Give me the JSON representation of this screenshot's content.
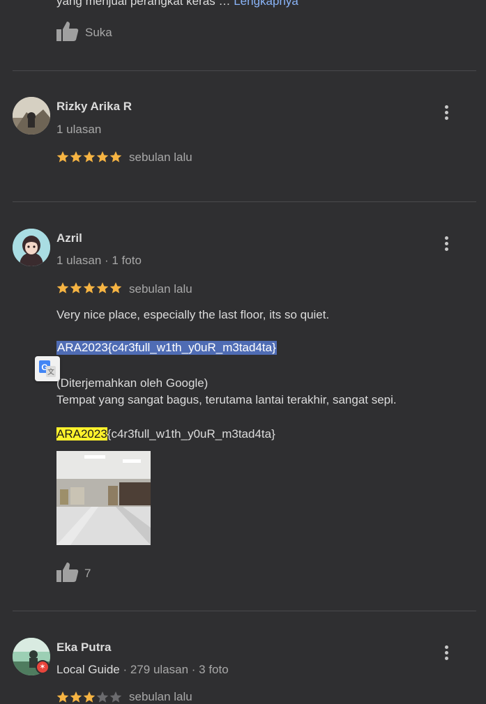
{
  "top_review": {
    "snippet": "yang menjual perangkat keras …",
    "more_link": "Lengkapnya",
    "like_label": "Suka"
  },
  "reviews": [
    {
      "name": "Rizky Arika R",
      "meta": "1 ulasan",
      "rating": 5,
      "time": "sebulan lalu"
    },
    {
      "name": "Azril",
      "meta": "1 ulasan · 1 foto",
      "rating": 5,
      "time": "sebulan lalu",
      "text": "Very nice place, especially the last floor, its so quiet.",
      "code": "ARA2023{c4r3full_w1th_y0uR_m3tad4ta}",
      "translated_by": "(Diterjemahkan oleh Google)",
      "translation": "Tempat yang sangat bagus, terutama lantai terakhir, sangat sepi.",
      "code2_highlight": "ARA2023",
      "code2_rest": "{c4r3full_w1th_y0uR_m3tad4ta}",
      "likes": "7"
    },
    {
      "name": "Eka Putra",
      "badge": "Local Guide",
      "meta": "· 279 ulasan · 3 foto",
      "rating": 3,
      "time": "sebulan lalu"
    }
  ],
  "colors": {
    "background": "#2f2f31",
    "star": "#f6b443",
    "link": "#8ab4f8",
    "selection": "#4f6cb4",
    "highlight": "#fff22c"
  }
}
